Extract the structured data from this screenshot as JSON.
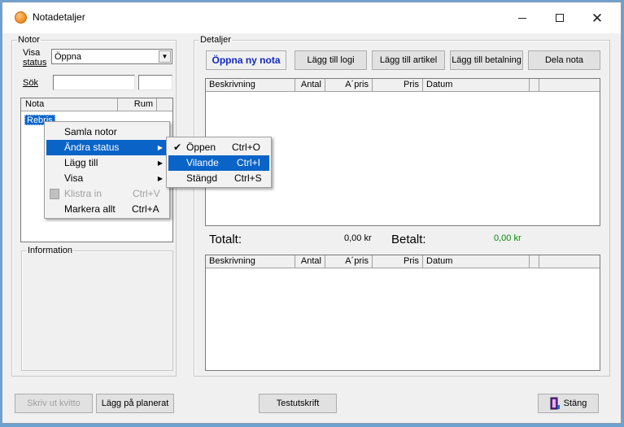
{
  "window": {
    "title": "Notadetaljer"
  },
  "notor": {
    "legend": "Notor",
    "visa_status_label_1": "Visa",
    "visa_status_label_2": "status",
    "status_value": "Öppna",
    "sok_label": "Sök",
    "list_headers": [
      "Nota",
      "Rum"
    ],
    "selected_item": "Rebris"
  },
  "information": {
    "legend": "Information"
  },
  "detaljer": {
    "legend": "Detaljer",
    "buttons": {
      "open_new": "Öppna ny nota",
      "add_logi": "Lägg till logi",
      "add_artikel": "Lägg till artikel",
      "add_betalning": "Lägg till betalning",
      "dela": "Dela nota"
    },
    "grid_headers": [
      "Beskrivning",
      "Antal",
      "A´pris",
      "Pris",
      "Datum"
    ],
    "totalt_label": "Totalt:",
    "totalt_value": "0,00 kr",
    "betalt_label": "Betalt:",
    "betalt_value": "0,00 kr"
  },
  "footer": {
    "skriv_ut": "Skriv ut kvitto",
    "lagg_pa": "Lägg på planerat",
    "testutskrift": "Testutskrift",
    "stang": "Stäng"
  },
  "context_menu": {
    "items": [
      {
        "label": "Samla notor",
        "shortcut": ""
      },
      {
        "label": "Ändra status",
        "shortcut": ""
      },
      {
        "label": "Lägg till",
        "shortcut": ""
      },
      {
        "label": "Visa",
        "shortcut": ""
      },
      {
        "label": "Klistra in",
        "shortcut": "Ctrl+V"
      },
      {
        "label": "Markera allt",
        "shortcut": "Ctrl+A"
      }
    ]
  },
  "status_submenu": {
    "items": [
      {
        "label": "Öppen",
        "shortcut": "Ctrl+O"
      },
      {
        "label": "Vilande",
        "shortcut": "Ctrl+I"
      },
      {
        "label": "Stängd",
        "shortcut": "Ctrl+S"
      }
    ]
  },
  "colors": {
    "accent": "#0a64c8",
    "betalt": "#0a8a0a",
    "primary_text": "#1428c0"
  }
}
